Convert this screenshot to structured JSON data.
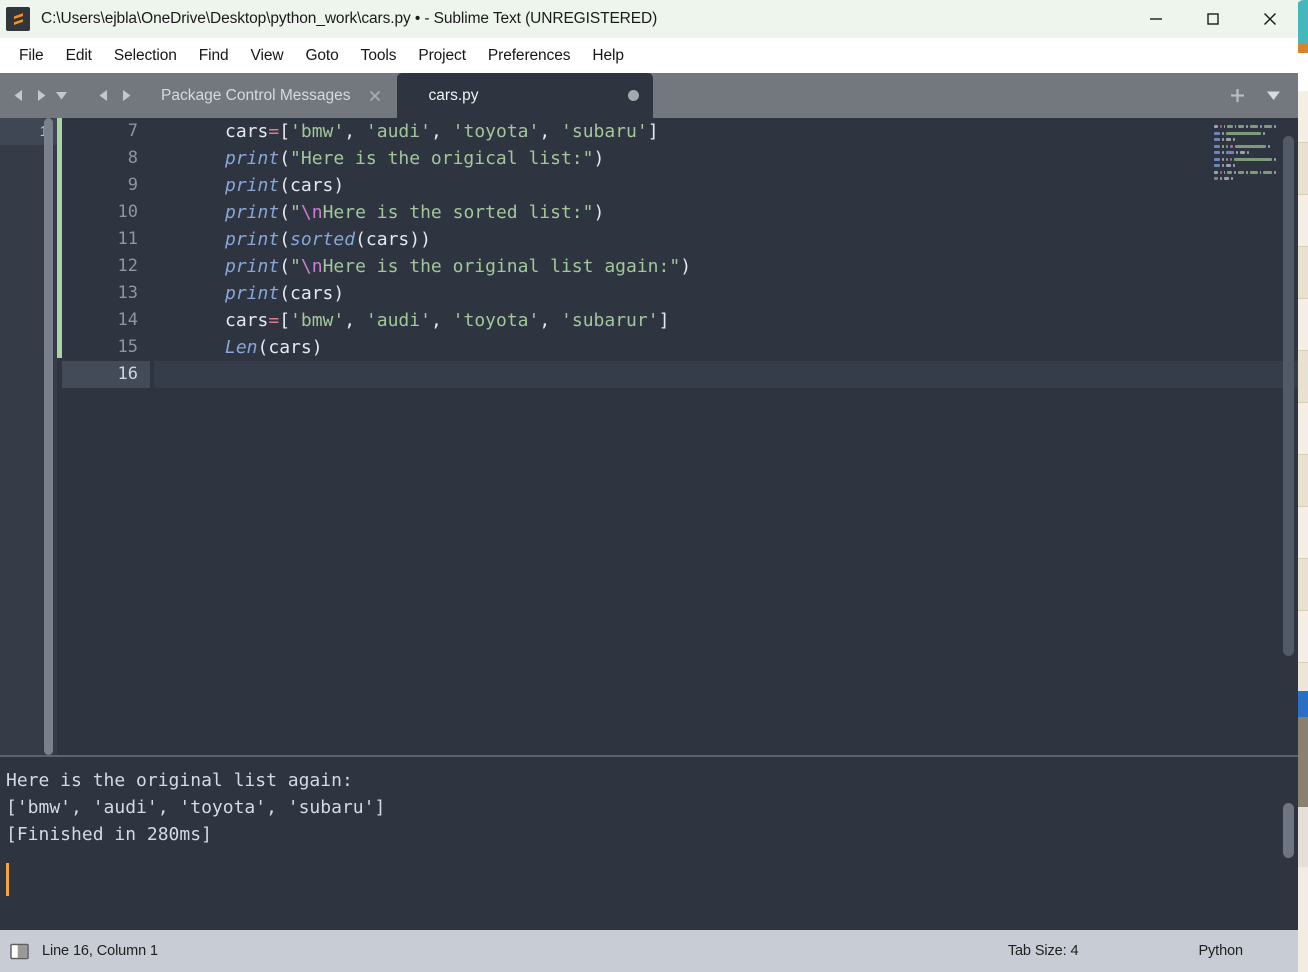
{
  "window": {
    "title": "C:\\Users\\ejbla\\OneDrive\\Desktop\\python_work\\cars.py • - Sublime Text (UNREGISTERED)",
    "logo_icon": "sublime-text-logo",
    "minimize_label": "—",
    "maximize_label": "□",
    "close_label": "✕",
    "minimize_icon": "minimize-icon",
    "maximize_icon": "maximize-icon",
    "close_icon": "close-icon"
  },
  "menu": {
    "items": [
      {
        "label": "File"
      },
      {
        "label": "Edit"
      },
      {
        "label": "Selection"
      },
      {
        "label": "Find"
      },
      {
        "label": "View"
      },
      {
        "label": "Goto"
      },
      {
        "label": "Tools"
      },
      {
        "label": "Project"
      },
      {
        "label": "Preferences"
      },
      {
        "label": "Help"
      }
    ]
  },
  "tabbar": {
    "nav_icons": [
      "arrow-left-icon",
      "arrow-right-icon",
      "chevron-down-icon",
      "arrow-left-icon",
      "arrow-right-icon"
    ],
    "tabs": [
      {
        "label": "Package Control Messages",
        "active": false,
        "close_icon": "close-icon"
      },
      {
        "label": "cars.py",
        "active": true,
        "dirty_icon": "unsaved-dot-icon"
      }
    ],
    "new_tab_icon": "plus-icon",
    "tab_menu_icon": "chevron-down-icon"
  },
  "sidebar": {
    "rows": [
      {
        "label": "1"
      }
    ]
  },
  "editor": {
    "lines": [
      {
        "number": "7",
        "current": false,
        "tokens": [
          {
            "text": "cars",
            "cls": "t-plain"
          },
          {
            "text": "=",
            "cls": "t-op"
          },
          {
            "text": "[",
            "cls": "t-brk"
          },
          {
            "text": "'bmw'",
            "cls": "t-str"
          },
          {
            "text": ", ",
            "cls": "t-punct"
          },
          {
            "text": "'audi'",
            "cls": "t-str"
          },
          {
            "text": ", ",
            "cls": "t-punct"
          },
          {
            "text": "'toyota'",
            "cls": "t-str"
          },
          {
            "text": ", ",
            "cls": "t-punct"
          },
          {
            "text": "'subaru'",
            "cls": "t-str"
          },
          {
            "text": "]",
            "cls": "t-brk"
          }
        ]
      },
      {
        "number": "8",
        "current": false,
        "tokens": [
          {
            "text": "print",
            "cls": "t-fn"
          },
          {
            "text": "(",
            "cls": "t-brk"
          },
          {
            "text": "\"Here is the origical list:\"",
            "cls": "t-str"
          },
          {
            "text": ")",
            "cls": "t-brk"
          }
        ]
      },
      {
        "number": "9",
        "current": false,
        "tokens": [
          {
            "text": "print",
            "cls": "t-fn"
          },
          {
            "text": "(",
            "cls": "t-brk"
          },
          {
            "text": "cars",
            "cls": "t-plain"
          },
          {
            "text": ")",
            "cls": "t-brk"
          }
        ]
      },
      {
        "number": "10",
        "current": false,
        "tokens": [
          {
            "text": "print",
            "cls": "t-fn"
          },
          {
            "text": "(",
            "cls": "t-brk"
          },
          {
            "text": "\"",
            "cls": "t-str"
          },
          {
            "text": "\\n",
            "cls": "t-esc"
          },
          {
            "text": "Here is the sorted list:\"",
            "cls": "t-str"
          },
          {
            "text": ")",
            "cls": "t-brk"
          }
        ]
      },
      {
        "number": "11",
        "current": false,
        "tokens": [
          {
            "text": "print",
            "cls": "t-fn"
          },
          {
            "text": "(",
            "cls": "t-brk"
          },
          {
            "text": "sorted",
            "cls": "t-fn"
          },
          {
            "text": "(",
            "cls": "t-brk"
          },
          {
            "text": "cars",
            "cls": "t-plain"
          },
          {
            "text": "))",
            "cls": "t-brk"
          }
        ]
      },
      {
        "number": "12",
        "current": false,
        "tokens": [
          {
            "text": "print",
            "cls": "t-fn"
          },
          {
            "text": "(",
            "cls": "t-brk"
          },
          {
            "text": "\"",
            "cls": "t-str"
          },
          {
            "text": "\\n",
            "cls": "t-esc"
          },
          {
            "text": "Here is the original list again:\"",
            "cls": "t-str"
          },
          {
            "text": ")",
            "cls": "t-brk"
          }
        ]
      },
      {
        "number": "13",
        "current": false,
        "tokens": [
          {
            "text": "print",
            "cls": "t-fn"
          },
          {
            "text": "(",
            "cls": "t-brk"
          },
          {
            "text": "cars",
            "cls": "t-plain"
          },
          {
            "text": ")",
            "cls": "t-brk"
          }
        ]
      },
      {
        "number": "14",
        "current": false,
        "tokens": [
          {
            "text": "cars",
            "cls": "t-plain"
          },
          {
            "text": "=",
            "cls": "t-op"
          },
          {
            "text": "[",
            "cls": "t-brk"
          },
          {
            "text": "'bmw'",
            "cls": "t-str"
          },
          {
            "text": ", ",
            "cls": "t-punct"
          },
          {
            "text": "'audi'",
            "cls": "t-str"
          },
          {
            "text": ", ",
            "cls": "t-punct"
          },
          {
            "text": "'toyota'",
            "cls": "t-str"
          },
          {
            "text": ", ",
            "cls": "t-punct"
          },
          {
            "text": "'subarur'",
            "cls": "t-str"
          },
          {
            "text": "]",
            "cls": "t-brk"
          }
        ]
      },
      {
        "number": "15",
        "current": false,
        "tokens": [
          {
            "text": "Len",
            "cls": "t-fn"
          },
          {
            "text": "(",
            "cls": "t-brk"
          },
          {
            "text": "cars",
            "cls": "t-plain"
          },
          {
            "text": ")",
            "cls": "t-brk"
          }
        ]
      },
      {
        "number": "16",
        "current": true,
        "tokens": []
      }
    ]
  },
  "output": {
    "lines": [
      "Here is the original list again:",
      "['bmw', 'audi', 'toyota', 'subaru']",
      "[Finished in 280ms]"
    ],
    "cursor_color": "#f2a541"
  },
  "statusbar": {
    "sidebar_toggle_icon": "sidebar-toggle-icon",
    "position": "Line 16, Column 1",
    "tab_size": "Tab Size: 4",
    "language": "Python"
  },
  "colors": {
    "titlebar_bg": "#eef5ec",
    "menubar_bg": "#ffffff",
    "tabbar_bg": "#73777e",
    "editor_bg": "#2e3440",
    "gutter_bg": "#353b47",
    "statusbar_bg": "#c8ccd4",
    "string": "#a3c79a",
    "function": "#88a7d8",
    "operator": "#e07a8a",
    "escape": "#cf7fd1",
    "changebar": "#a8d5a2",
    "accent_orange": "#f2a541"
  }
}
